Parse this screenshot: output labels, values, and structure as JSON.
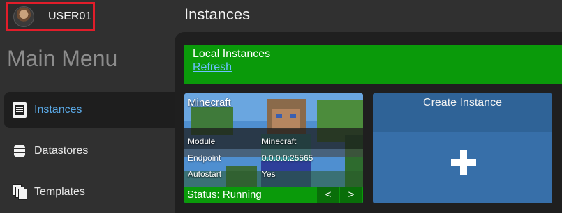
{
  "user": {
    "name": "USER01"
  },
  "main_menu": {
    "title": "Main Menu"
  },
  "sidebar": {
    "items": [
      {
        "label": "Instances",
        "icon": "film-icon",
        "active": true
      },
      {
        "label": "Datastores",
        "icon": "database-icon",
        "active": false
      },
      {
        "label": "Templates",
        "icon": "templates-icon",
        "active": false
      }
    ]
  },
  "page": {
    "title": "Instances"
  },
  "local_instances": {
    "title": "Local Instances",
    "refresh_label": "Refresh"
  },
  "instances": [
    {
      "name": "Minecraft",
      "module_label": "Module",
      "module_value": "Minecraft",
      "endpoint_label": "Endpoint",
      "endpoint_value": "0.0.0.0:25565",
      "autostart_label": "Autostart",
      "autostart_value": "Yes",
      "status": "Status: Running",
      "prev_label": "<",
      "next_label": ">"
    }
  ],
  "create_instance": {
    "label": "Create Instance",
    "icon": "plus-icon"
  },
  "colors": {
    "accent_blue": "#5aa9e6",
    "running_green": "#0a9a0a",
    "highlight_red": "#e11d2a",
    "create_blue": "#376fa9"
  }
}
